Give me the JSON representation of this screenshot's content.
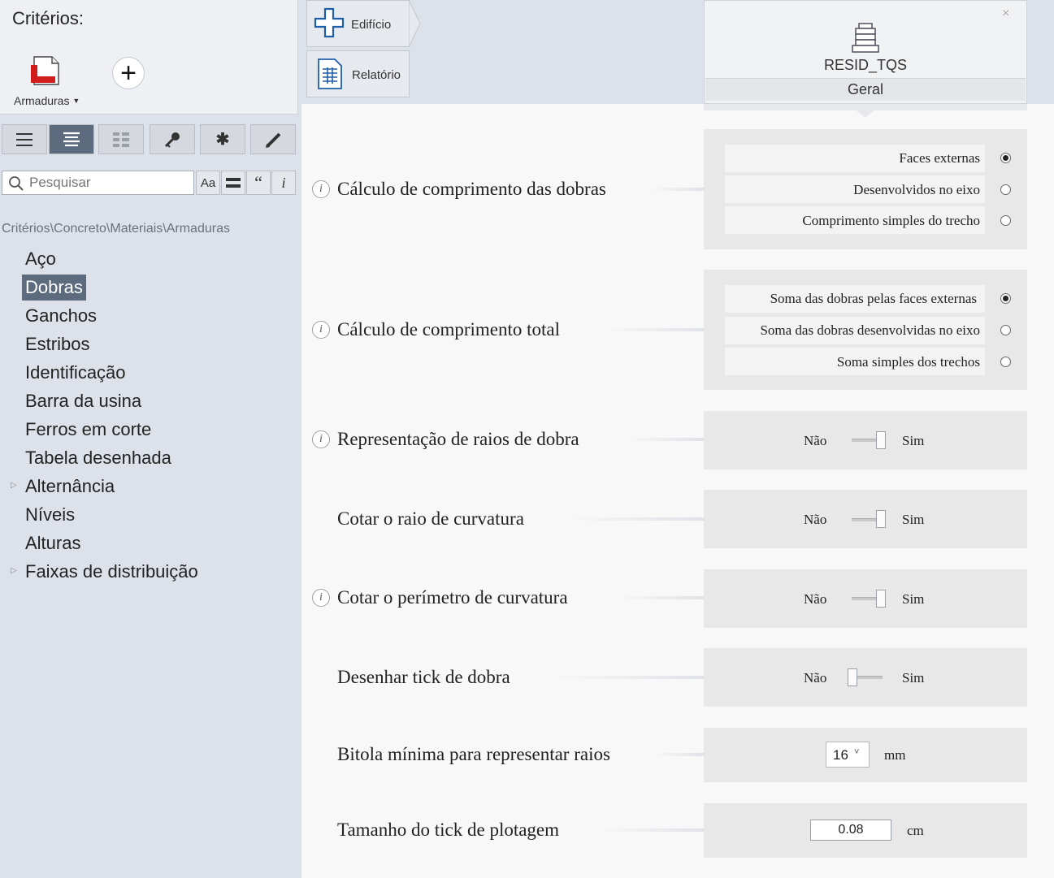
{
  "criteria_panel": {
    "title": "Critérios:",
    "armaduras_label": "Armaduras",
    "add_label": "+"
  },
  "toolbar": {
    "tools": [
      "list-icon",
      "detail-list-icon",
      "grid-icon",
      "key-icon",
      "asterisk-icon",
      "pencil-icon"
    ],
    "active_index": 1
  },
  "search": {
    "placeholder": "Pesquisar",
    "value": "",
    "btn_case": "Aa",
    "btn_quote": "“",
    "btn_info": "i"
  },
  "breadcrumb": "Critérios\\Concreto\\Materiais\\Armaduras",
  "tree": {
    "items": [
      {
        "label": "Aço"
      },
      {
        "label": "Dobras"
      },
      {
        "label": "Ganchos"
      },
      {
        "label": "Estribos"
      },
      {
        "label": "Identificação"
      },
      {
        "label": "Barra da usina"
      },
      {
        "label": "Ferros em corte"
      },
      {
        "label": "Tabela desenhada"
      },
      {
        "label": "Alternância"
      },
      {
        "label": "Níveis"
      },
      {
        "label": "Alturas"
      },
      {
        "label": "Faixas de distribuição"
      }
    ],
    "selected": "Dobras"
  },
  "nav": {
    "edificio": "Edifício",
    "relatorio": "Relatório"
  },
  "resid": {
    "name": "RESID_TQS",
    "tab": "Geral",
    "close": "×"
  },
  "settings": {
    "calc_dobras": {
      "label": "Cálculo de comprimento das dobras",
      "options": [
        "Faces externas",
        "Desenvolvidos no eixo",
        "Comprimento simples do trecho"
      ],
      "selected": 0
    },
    "calc_total": {
      "label": "Cálculo de comprimento total",
      "options": [
        "Soma das dobras pelas faces externas",
        "Soma das dobras desenvolvidas no eixo",
        "Soma simples dos trechos"
      ],
      "selected": 0
    },
    "repr_raios": {
      "label": "Representação de raios de dobra",
      "no": "Não",
      "yes": "Sim",
      "value": true
    },
    "cotar_raio": {
      "label": "Cotar o raio de curvatura",
      "no": "Não",
      "yes": "Sim",
      "value": true
    },
    "cotar_perimetro": {
      "label": "Cotar o perímetro de curvatura",
      "no": "Não",
      "yes": "Sim",
      "value": true
    },
    "desenhar_tick": {
      "label": "Desenhar tick de dobra",
      "no": "Não",
      "yes": "Sim",
      "value": false
    },
    "bitola_minima": {
      "label": "Bitola mínima para representar raios",
      "value": "16",
      "unit": "mm"
    },
    "tamanho_tick": {
      "label": "Tamanho do tick de plotagem",
      "value": "0.08",
      "unit": "cm"
    }
  }
}
